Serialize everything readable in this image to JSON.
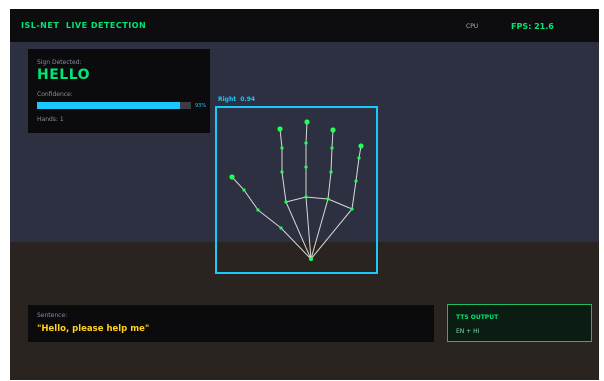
{
  "header": {
    "title": "ISL-NET  LIVE DETECTION",
    "cpu_label": "CPU",
    "fps_label": "FPS: 21.6"
  },
  "detection": {
    "sign_label": "Sign Detected:",
    "sign_value": "HELLO",
    "confidence_label": "Confidence:",
    "confidence_fraction": 0.93,
    "confidence_text": "93%",
    "hands_text": "Hands: 1"
  },
  "hand": {
    "tag": "Right  0.94"
  },
  "sentence": {
    "label": "Sentence:",
    "text": "\"Hello, please help me\""
  },
  "tts": {
    "title": "TTS OUTPUT",
    "value": "EN + HI"
  },
  "colors": {
    "accent_green": "#00e676",
    "accent_cyan": "#19c8ff",
    "sentence_yellow": "#ffd21f",
    "skeleton_line": "#d8d8d8",
    "joint_green": "#22ff55"
  },
  "icons": {
    "landmark": "joint-dot"
  }
}
